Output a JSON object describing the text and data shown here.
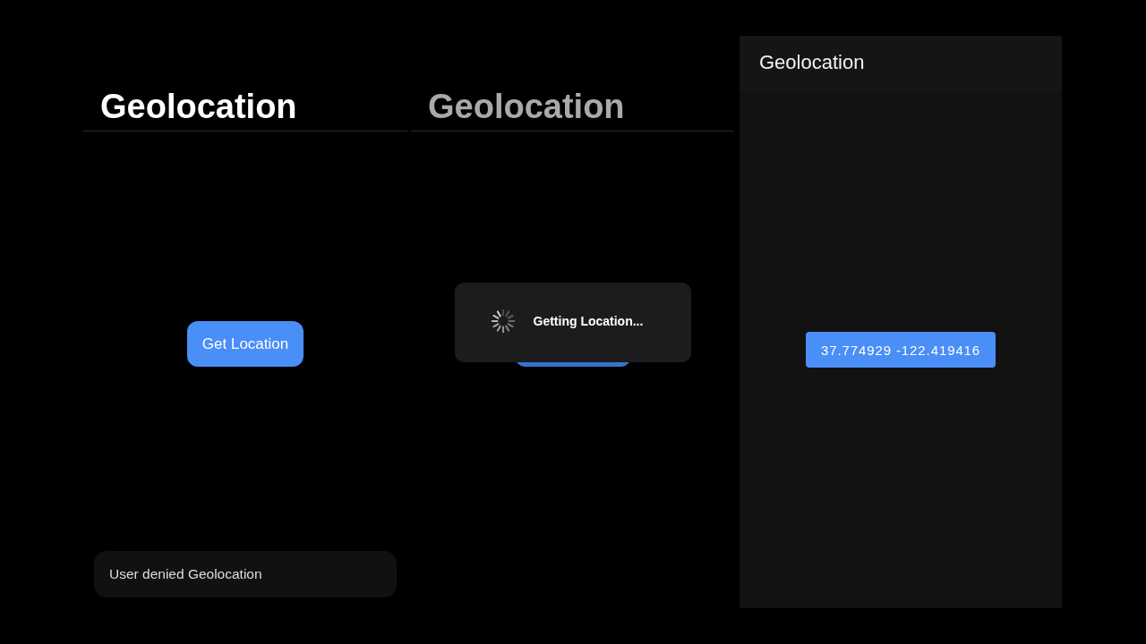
{
  "panels": [
    {
      "kind": "ios",
      "title": "Geolocation",
      "dimmed": false,
      "button": {
        "label": "Get Location",
        "covered": false
      },
      "toast": {
        "text": "User denied Geolocation"
      }
    },
    {
      "kind": "ios",
      "title": "Geolocation",
      "dimmed": true,
      "button": {
        "covered": true
      },
      "loading": {
        "text": "Getting Location..."
      }
    },
    {
      "kind": "material",
      "title": "Geolocation",
      "button": {
        "label": "37.774929 -122.419416"
      }
    }
  ]
}
